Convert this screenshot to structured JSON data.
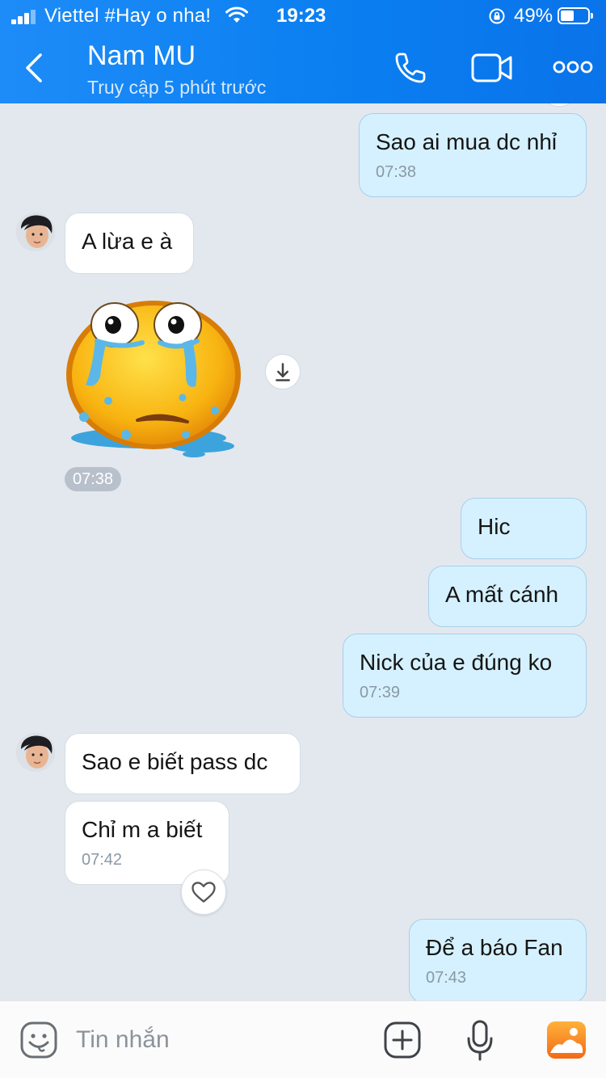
{
  "status_bar": {
    "carrier": "Viettel #Hay o nha!",
    "time": "19:23",
    "battery_percent": "49%",
    "battery_level": 0.49
  },
  "header": {
    "contact_name": "Nam MU",
    "contact_status": "Truy cập 5 phút trước",
    "accent_color": "#0a7ef0"
  },
  "messages": {
    "m1": {
      "text": "Sao ai mua dc nhỉ",
      "time": "07:38",
      "direction": "outgoing"
    },
    "m2": {
      "text": "A lừa e à",
      "direction": "incoming"
    },
    "sticker": {
      "name": "crying-face-sticker",
      "time": "07:38",
      "direction": "incoming"
    },
    "m3": {
      "text": "Hic",
      "direction": "outgoing"
    },
    "m4": {
      "text": "A mất cánh",
      "direction": "outgoing"
    },
    "m5": {
      "text": "Nick của e đúng ko",
      "time": "07:39",
      "direction": "outgoing"
    },
    "m6": {
      "text": "Sao e biết pass dc",
      "direction": "incoming"
    },
    "m7": {
      "text": "Chỉ m a biết",
      "time": "07:42",
      "direction": "incoming"
    },
    "m8": {
      "text": "Để a báo Fan",
      "time": "07:43",
      "direction": "outgoing"
    }
  },
  "input_bar": {
    "placeholder": "Tin nhắn",
    "icons": [
      "emoji-icon",
      "add-icon",
      "microphone-icon",
      "gallery-icon"
    ]
  }
}
